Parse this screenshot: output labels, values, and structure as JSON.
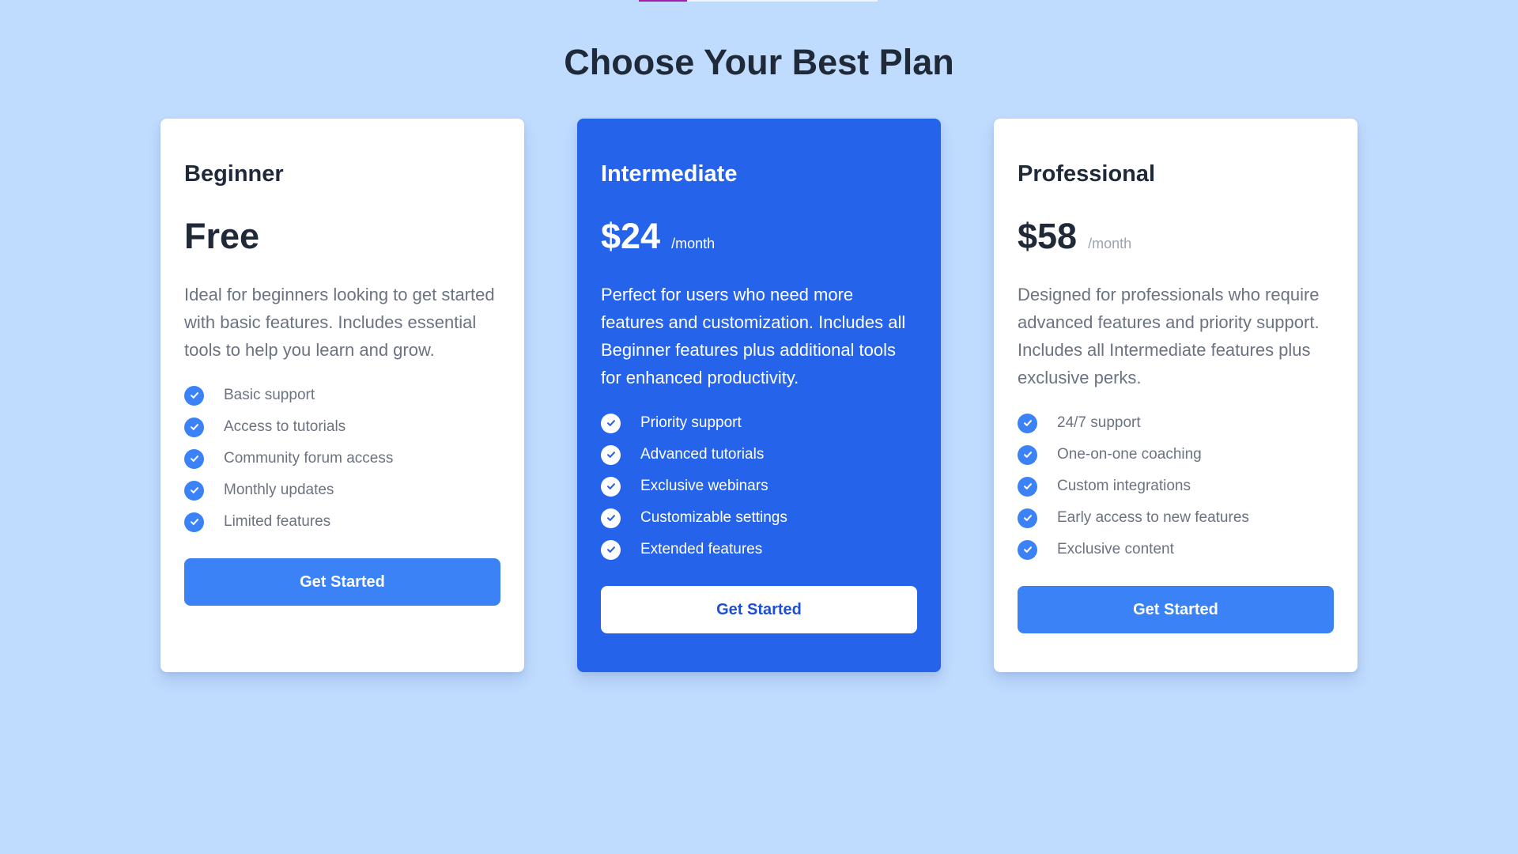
{
  "page": {
    "title": "Choose Your Best Plan"
  },
  "colors": {
    "background": "#bfdbfe",
    "card": "#ffffff",
    "highlight_card": "#2563eb",
    "accent": "#3b82f6",
    "heading": "#1f2937",
    "muted_text": "#6b7280"
  },
  "plans": [
    {
      "name": "Beginner",
      "price": "Free",
      "period": "",
      "description": "Ideal for beginners looking to get started with basic features. Includes essential tools to help you learn and grow.",
      "features": [
        "Basic support",
        "Access to tutorials",
        "Community forum access",
        "Monthly updates",
        "Limited features"
      ],
      "cta": "Get Started",
      "highlighted": false
    },
    {
      "name": "Intermediate",
      "price": "$24",
      "period": "/month",
      "description": "Perfect for users who need more features and customization. Includes all Beginner features plus additional tools for enhanced productivity.",
      "features": [
        "Priority support",
        "Advanced tutorials",
        "Exclusive webinars",
        "Customizable settings",
        "Extended features"
      ],
      "cta": "Get Started",
      "highlighted": true
    },
    {
      "name": "Professional",
      "price": "$58",
      "period": "/month",
      "description": "Designed for professionals who require advanced features and priority support. Includes all Intermediate features plus exclusive perks.",
      "features": [
        "24/7 support",
        "One-on-one coaching",
        "Custom integrations",
        "Early access to new features",
        "Exclusive content"
      ],
      "cta": "Get Started",
      "highlighted": false
    }
  ],
  "icons": {
    "feature_bullet": "check-circle-icon"
  }
}
